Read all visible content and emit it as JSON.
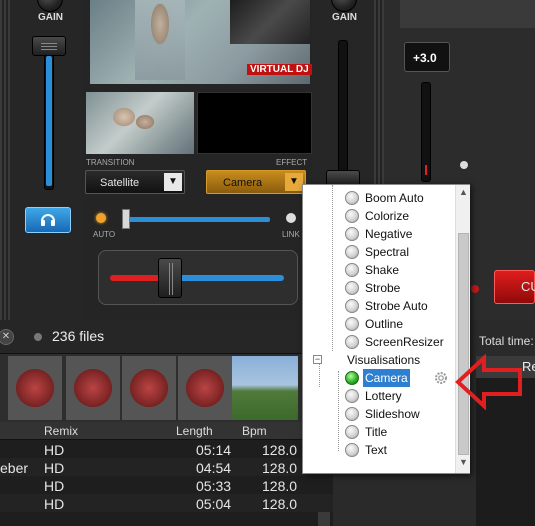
{
  "left_deck": {
    "gain_label": "GAIN",
    "headphone_icon": "headphone-icon"
  },
  "center": {
    "transition_label": "TRANSITION",
    "effect_label": "EFFECT",
    "transition_value": "Satellite",
    "effect_value": "Camera",
    "auto_label": "AUTO",
    "link_label": "LINK",
    "video_watermark": "VIRTUAL DJ"
  },
  "right_deck": {
    "gain_label": "GAIN",
    "pitch_value": "+3.0",
    "total_time_label": "Total time:",
    "red_button_label": "CU",
    "re_label": "Re"
  },
  "browser": {
    "file_count": "236 files",
    "columns": [
      "Remix",
      "Length",
      "Bpm"
    ],
    "rows": [
      {
        "title": "",
        "remix": "HD",
        "length": "05:14",
        "bpm": "128.0"
      },
      {
        "title": "eber",
        "remix": "HD",
        "length": "04:54",
        "bpm": "128.0"
      },
      {
        "title": "",
        "remix": "HD",
        "length": "05:33",
        "bpm": "128.0"
      },
      {
        "title": "",
        "remix": "HD",
        "length": "05:04",
        "bpm": "128.0"
      }
    ]
  },
  "menu": {
    "items": [
      {
        "label": "Boom Auto",
        "active": false
      },
      {
        "label": "Colorize",
        "active": false
      },
      {
        "label": "Negative",
        "active": false
      },
      {
        "label": "Spectral",
        "active": false
      },
      {
        "label": "Shake",
        "active": false
      },
      {
        "label": "Strobe",
        "active": false
      },
      {
        "label": "Strobe Auto",
        "active": false
      },
      {
        "label": "Outline",
        "active": false
      },
      {
        "label": "ScreenResizer",
        "active": false
      }
    ],
    "group_label": "Visualisations",
    "vis_items": [
      {
        "label": "Camera",
        "active": true
      },
      {
        "label": "Lottery",
        "active": false
      },
      {
        "label": "Slideshow",
        "active": false
      },
      {
        "label": "Title",
        "active": false
      },
      {
        "label": "Text",
        "active": false
      }
    ]
  },
  "colors": {
    "accent_blue": "#2a8fd8",
    "effect_orange": "#c98c1d",
    "selection_blue": "#2f7fd0",
    "annotation_red": "#e02020"
  }
}
